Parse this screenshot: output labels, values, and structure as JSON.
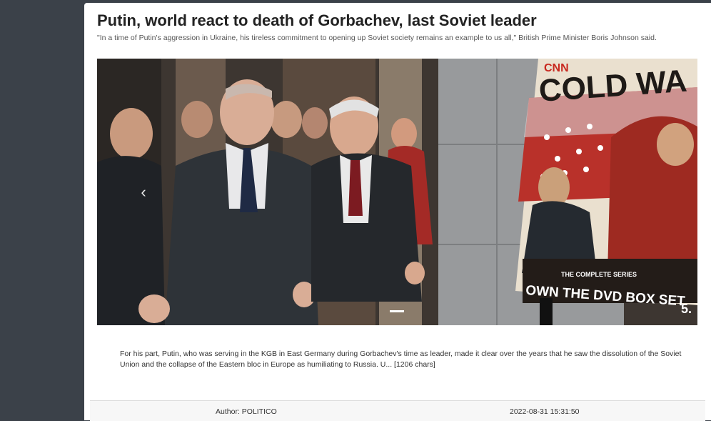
{
  "article": {
    "title": "Putin, world react to death of Gorbachev, last Soviet leader",
    "subtitle": "\"In a time of Putin's aggression in Ukraine, his tireless commitment to opening up Soviet society remains an example to us all,\" British Prime Minister Boris Johnson said.",
    "body": "For his part, Putin, who was serving in the KGB in East Germany during Gorbachev's time as leader, made it clear over the years that he saw the dissolution of the Soviet Union and the collapse of the Eastern bloc in Europe as humiliating to Russia. U... [1206 chars]",
    "author": "Author: POLITICO",
    "published": "2022-08-31 15:31:50"
  },
  "carousel": {
    "prev_glyph": "‹",
    "poster": {
      "brand": "CNN",
      "headline": "COLD WA",
      "series": "THE COMPLETE SERIES",
      "tagline": "OWN THE DVD BOX SET",
      "number": "5."
    }
  },
  "colors": {
    "sidebar": "#3b4149",
    "card": "#ffffff",
    "footer": "#f7f7f7",
    "poster_red": "#c8281f"
  }
}
